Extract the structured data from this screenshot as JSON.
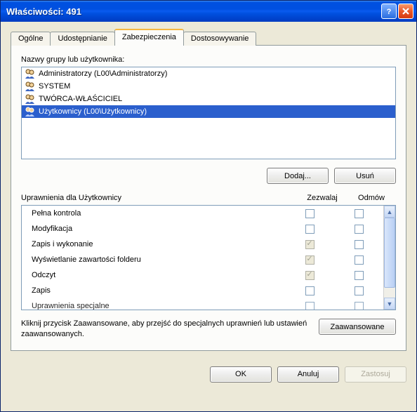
{
  "window": {
    "title": "Właściwości: 491"
  },
  "tabs": [
    {
      "label": "Ogólne"
    },
    {
      "label": "Udostępnianie"
    },
    {
      "label": "Zabezpieczenia"
    },
    {
      "label": "Dostosowywanie"
    }
  ],
  "groups_label": "Nazwy grupy lub użytkownika:",
  "groups": [
    {
      "label": "Administratorzy (L00\\Administratorzy)"
    },
    {
      "label": "SYSTEM"
    },
    {
      "label": "TWÓRCA-WŁAŚCICIEL"
    },
    {
      "label": "Użytkownicy (L00\\Użytkownicy)"
    }
  ],
  "buttons": {
    "add": "Dodaj...",
    "remove": "Usuń",
    "advanced": "Zaawansowane",
    "ok": "OK",
    "cancel": "Anuluj",
    "apply": "Zastosuj"
  },
  "perm_header": {
    "title": "Uprawnienia dla Użytkownicy",
    "allow": "Zezwalaj",
    "deny": "Odmów"
  },
  "permissions": [
    {
      "name": "Pełna kontrola",
      "allow": "unchecked",
      "deny": "unchecked"
    },
    {
      "name": "Modyfikacja",
      "allow": "unchecked",
      "deny": "unchecked"
    },
    {
      "name": "Zapis i wykonanie",
      "allow": "checked-disabled",
      "deny": "unchecked"
    },
    {
      "name": "Wyświetlanie zawartości folderu",
      "allow": "checked-disabled",
      "deny": "unchecked"
    },
    {
      "name": "Odczyt",
      "allow": "checked-disabled",
      "deny": "unchecked"
    },
    {
      "name": "Zapis",
      "allow": "unchecked",
      "deny": "unchecked"
    },
    {
      "name": "Uprawnienia specjalne",
      "allow": "unchecked",
      "deny": "unchecked"
    }
  ],
  "advanced_text": "Kliknij przycisk Zaawansowane, aby przejść do specjalnych uprawnień lub ustawień zaawansowanych."
}
